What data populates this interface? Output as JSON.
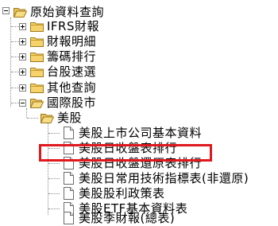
{
  "tree": {
    "root": {
      "label": "原始資料查詢",
      "icon": "folder-open-icon"
    },
    "level1": [
      {
        "label": "IFRS財報",
        "icon": "folder-icon"
      },
      {
        "label": "財報明細",
        "icon": "folder-icon"
      },
      {
        "label": "籌碼排行",
        "icon": "folder-icon"
      },
      {
        "label": "台股速選",
        "icon": "folder-icon"
      },
      {
        "label": "其他查詢",
        "icon": "folder-icon"
      },
      {
        "label": "國際股市",
        "icon": "folder-open-icon"
      }
    ],
    "level2": [
      {
        "label": "美股",
        "icon": "folder-open-icon"
      }
    ],
    "level3": [
      {
        "label": "美股上市公司基本資料",
        "icon": "document-icon"
      },
      {
        "label": "美股日收盤表排行",
        "icon": "document-icon"
      },
      {
        "label": "美股日收盤還原表排行",
        "icon": "document-icon"
      },
      {
        "label": "美股日常用技術指標表(非還原)",
        "icon": "document-icon"
      },
      {
        "label": "美股股利政策表",
        "icon": "document-icon"
      },
      {
        "label": "美股ETF基本資料表",
        "icon": "document-icon"
      },
      {
        "label": "美股季財報(總表)",
        "icon": "document-icon"
      }
    ]
  },
  "colors": {
    "highlight": "#e0181d",
    "folder": "#f5d26b",
    "tree_line": "#8a8a8a"
  }
}
